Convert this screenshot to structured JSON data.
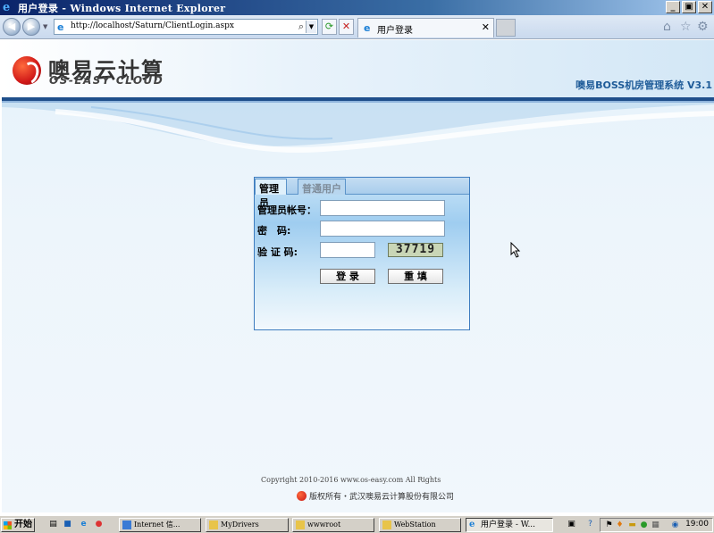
{
  "window": {
    "title": "用户登录 - Windows Internet Explorer",
    "controls": {
      "minimize": "_",
      "maximize": "▣",
      "close": "✕"
    }
  },
  "browser": {
    "address": "http://localhost/Saturn/ClientLogin.aspx",
    "tab_label": "用户登录"
  },
  "header": {
    "logo_cn": "噢易云计算",
    "logo_en": "OS-EASY CLOUD",
    "system_name": "噢易BOSS机房管理系统 V3.1"
  },
  "login": {
    "tabs": [
      {
        "label": "管理员",
        "active": true
      },
      {
        "label": "普通用户",
        "active": false
      }
    ],
    "account_label": "管理员帐号：",
    "password_label": "密　码:",
    "captcha_label": "验 证 码:",
    "account_value": "",
    "password_value": "",
    "captcha_value": "",
    "captcha_image_text": "37719",
    "login_button": "登 录",
    "reset_button": "重 填"
  },
  "footer": {
    "copyright": "Copyright  2010-2016 www.os-easy.com All Rights",
    "company": "版权所有・武汉噢易云计算股份有限公司"
  },
  "taskbar": {
    "start": "开始",
    "tasks": [
      {
        "label": "Internet 信...",
        "active": false
      },
      {
        "label": "MyDrivers",
        "active": false
      },
      {
        "label": "wwwroot",
        "active": false
      },
      {
        "label": "WebStation",
        "active": false
      },
      {
        "label": "用户登录 - W...",
        "active": true
      }
    ],
    "clock": "19:00"
  }
}
